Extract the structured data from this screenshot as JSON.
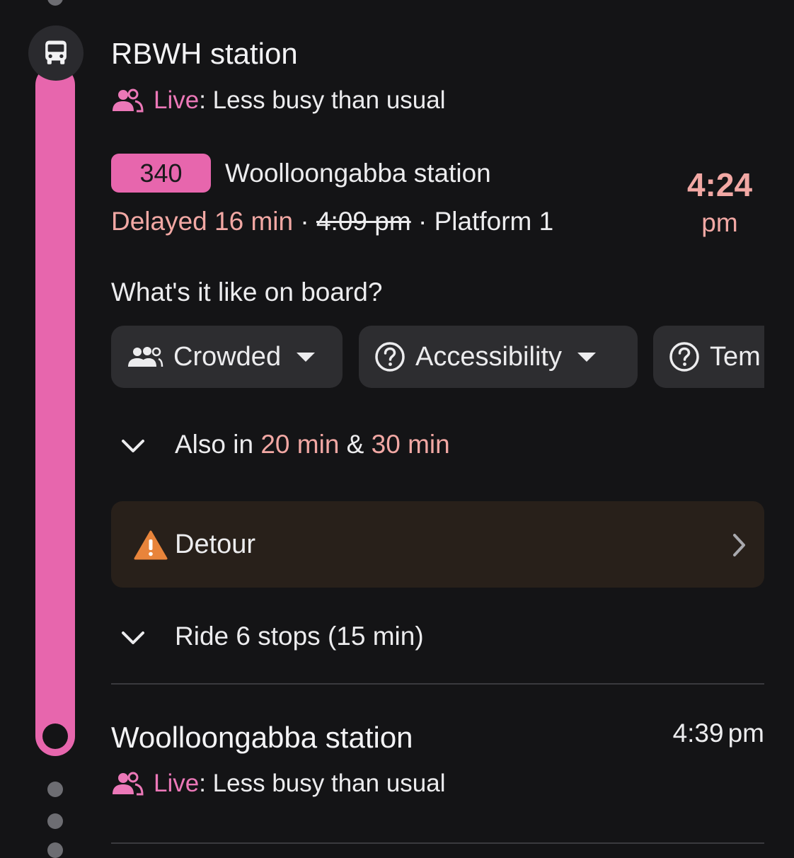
{
  "origin": {
    "name": "RBWH station",
    "live_label": "Live",
    "live_status": ": Less busy than usual"
  },
  "service": {
    "route": "340",
    "destination": "Woolloongabba station",
    "delay": "Delayed 16 min",
    "separator": " · ",
    "scheduled": "4:09 pm",
    "platform": "Platform 1",
    "time": "4:24",
    "time_unit": "pm"
  },
  "onboard": {
    "question": "What's it like on board?",
    "chips": [
      {
        "label": "Crowded",
        "icon": "people-icon"
      },
      {
        "label": "Accessibility",
        "icon": "help-circle-icon"
      },
      {
        "label": "Tem",
        "icon": "help-circle-icon"
      }
    ]
  },
  "also": {
    "prefix": "Also in ",
    "first": "20 min",
    "joiner": " & ",
    "second": "30 min"
  },
  "alert": {
    "label": "Detour",
    "icon": "warning-icon"
  },
  "ride": {
    "label": "Ride 6 stops (15 min)"
  },
  "destination_stop": {
    "name": "Woolloongabba station",
    "time": "4:39",
    "time_unit": "pm",
    "live_label": "Live",
    "live_status": ": Less busy than usual"
  },
  "colors": {
    "accent_pink": "#e766ad",
    "delay_salmon": "#f2a8a4",
    "background": "#141416",
    "chip_bg": "#2d2d30",
    "alert_bg": "#28201a",
    "warning_orange": "#e8843b"
  }
}
